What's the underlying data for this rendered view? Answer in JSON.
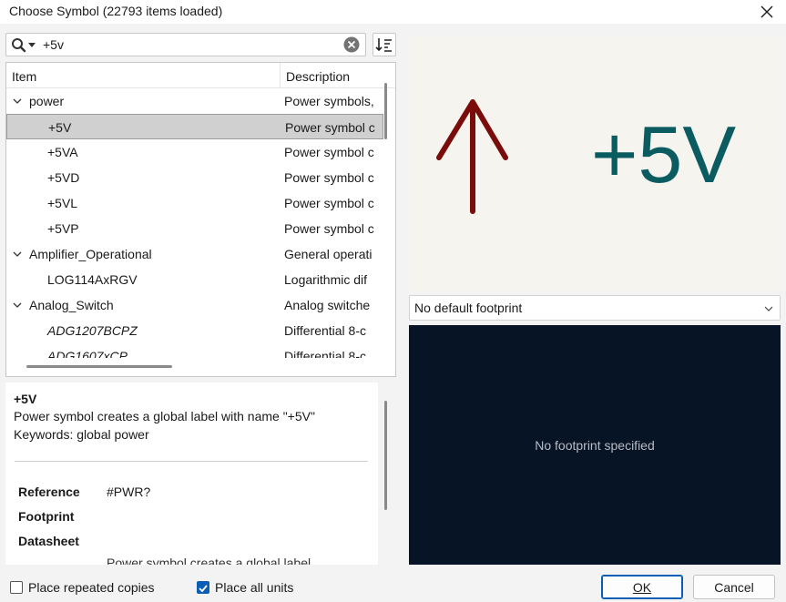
{
  "window": {
    "title": "Choose Symbol (22793 items loaded)"
  },
  "search": {
    "value": "+5v",
    "placeholder": ""
  },
  "tree": {
    "col_item": "Item",
    "col_description": "Description",
    "rows": [
      {
        "name": "power",
        "desc": "Power symbols,",
        "type": "library"
      },
      {
        "name": "+5V",
        "desc": "Power symbol c",
        "type": "symbol",
        "selected": true
      },
      {
        "name": "+5VA",
        "desc": "Power symbol c",
        "type": "symbol"
      },
      {
        "name": "+5VD",
        "desc": "Power symbol c",
        "type": "symbol"
      },
      {
        "name": "+5VL",
        "desc": "Power symbol c",
        "type": "symbol"
      },
      {
        "name": "+5VP",
        "desc": "Power symbol c",
        "type": "symbol"
      },
      {
        "name": "Amplifier_Operational",
        "desc": "General operati",
        "type": "library"
      },
      {
        "name": "LOG114AxRGV",
        "desc": "Logarithmic dif",
        "type": "symbol"
      },
      {
        "name": "Analog_Switch",
        "desc": "Analog switche",
        "type": "library"
      },
      {
        "name": "ADG1207BCPZ",
        "desc": "Differential 8-c",
        "type": "symbol",
        "italic": true
      },
      {
        "name": "ADG1607xCP",
        "desc": "Differential 8-c",
        "type": "symbol",
        "italic": true
      }
    ]
  },
  "info": {
    "name": "+5V",
    "description": "Power symbol creates a global label with name \"+5V\"",
    "keywords": "Keywords: global power",
    "fields": [
      {
        "label": "Reference",
        "value": "#PWR?"
      },
      {
        "label": "Footprint",
        "value": ""
      },
      {
        "label": "Datasheet",
        "value": ""
      }
    ],
    "cut_text": "Power symbol creates a global label"
  },
  "symbol": {
    "label": "+5V",
    "arrow_color": "#7a0c0c",
    "text_color": "#0a5c61"
  },
  "footprint": {
    "selected": "No default footprint",
    "empty_message": "No footprint specified"
  },
  "options": {
    "repeat_label": "Place repeated copies",
    "repeat_checked": false,
    "all_units_label": "Place all units",
    "all_units_checked": true
  },
  "buttons": {
    "ok": "OK",
    "cancel": "Cancel"
  },
  "icons": [
    "close-icon",
    "search-icon",
    "clear-icon",
    "sort-icon",
    "chevron-down-icon",
    "checkmark-icon"
  ]
}
